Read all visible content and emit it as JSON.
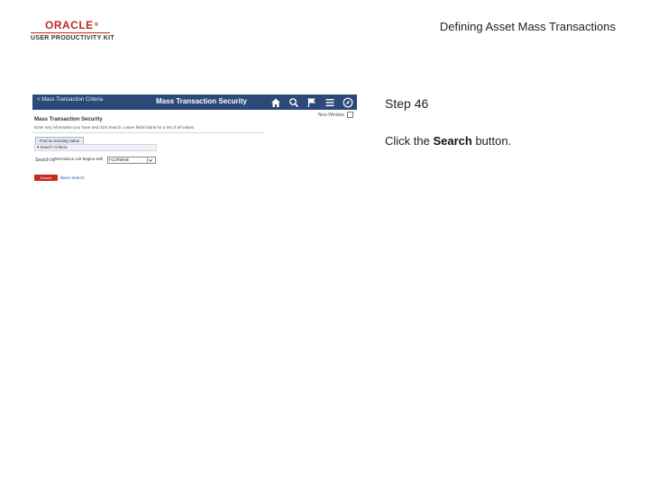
{
  "logo": {
    "brand": "ORACLE",
    "trademark": "®",
    "subtitle": "USER PRODUCTIVITY KIT"
  },
  "doc_title": "Defining Asset Mass Transactions",
  "step": {
    "number_text": "Step 46",
    "instruction_prefix": "Click the ",
    "instruction_target": "Search",
    "instruction_suffix": " button."
  },
  "screenshot": {
    "navbar": {
      "back_label": "< Mass Transaction Criteria",
      "title": "Mass Transaction Security",
      "icons": [
        "home-icon",
        "search-icon",
        "flag-icon",
        "menu-icon",
        "compass-icon"
      ],
      "color": "#2b4a77"
    },
    "new_window_label": "New Window",
    "page_title": "Mass Transaction Security",
    "page_description": "Enter any information you have and click Search. Leave fields blank for a list of all values.",
    "tab_find_label": "Find an Existing Value",
    "criteria_label": "▾ Search Criteria",
    "search_by": {
      "label": "Search by:",
      "operator_text": "Permission List begins with",
      "value": "FLCRWAB",
      "lookup_icon": "chevron-down-icon"
    },
    "search_button_label": "Search",
    "search_button_color": "#c8281f",
    "basic_search_link": "Basic Search"
  }
}
